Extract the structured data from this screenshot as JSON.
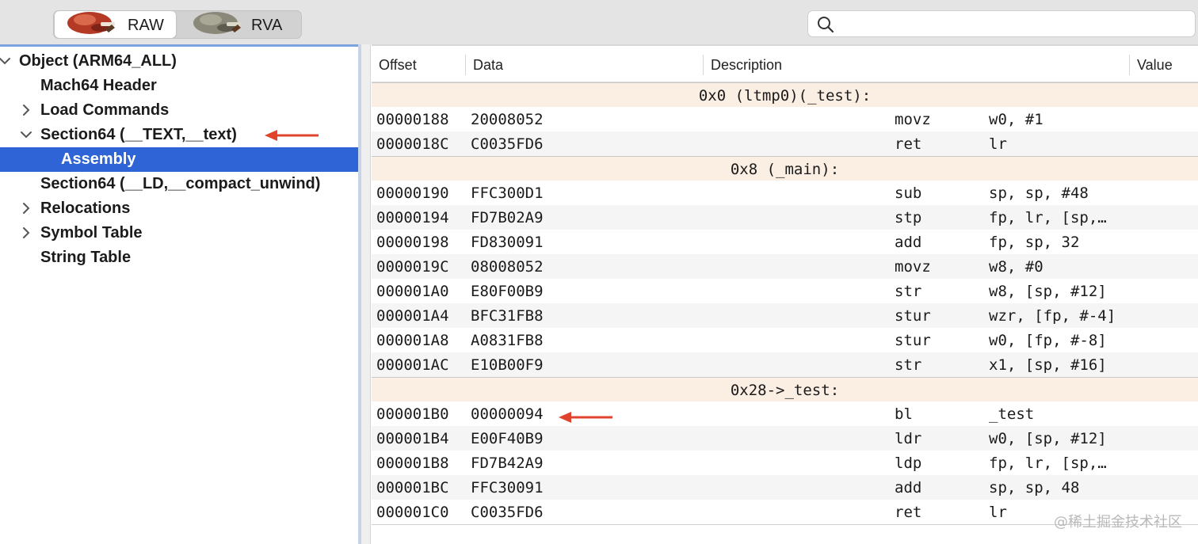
{
  "toolbar": {
    "mode_raw": "RAW",
    "mode_rva": "RVA",
    "search_placeholder": ""
  },
  "tree": {
    "items": [
      {
        "label": "Object  (ARM64_ALL)",
        "level": 0,
        "disclosure": "expanded-check"
      },
      {
        "label": "Mach64 Header",
        "level": 1,
        "disclosure": "none"
      },
      {
        "label": "Load Commands",
        "level": 1,
        "disclosure": "collapsed"
      },
      {
        "label": "Section64 (__TEXT,__text)",
        "level": 1,
        "disclosure": "expanded"
      },
      {
        "label": "Assembly",
        "level": 2,
        "disclosure": "none",
        "selected": true
      },
      {
        "label": "Section64 (__LD,__compact_unwind)",
        "level": 1,
        "disclosure": "none"
      },
      {
        "label": "Relocations",
        "level": 1,
        "disclosure": "collapsed"
      },
      {
        "label": "Symbol Table",
        "level": 1,
        "disclosure": "collapsed"
      },
      {
        "label": "String Table",
        "level": 1,
        "disclosure": "none"
      }
    ]
  },
  "table": {
    "columns": [
      "Offset",
      "Data",
      "Description",
      "Value"
    ],
    "rows": [
      {
        "label": "0x0 (ltmp0)(_test):"
      },
      {
        "offset": "00000188",
        "data": "20008052",
        "mnemonic": "movz",
        "operands": "w0, #1"
      },
      {
        "offset": "0000018C",
        "data": "C0035FD6",
        "mnemonic": "ret",
        "operands": "lr"
      },
      {
        "label": "0x8 (_main):"
      },
      {
        "offset": "00000190",
        "data": "FFC300D1",
        "mnemonic": "sub",
        "operands": "sp, sp, #48"
      },
      {
        "offset": "00000194",
        "data": "FD7B02A9",
        "mnemonic": "stp",
        "operands": "fp, lr, [sp,…"
      },
      {
        "offset": "00000198",
        "data": "FD830091",
        "mnemonic": "add",
        "operands": "fp, sp, 32"
      },
      {
        "offset": "0000019C",
        "data": "08008052",
        "mnemonic": "movz",
        "operands": "w8, #0"
      },
      {
        "offset": "000001A0",
        "data": "E80F00B9",
        "mnemonic": "str",
        "operands": "w8, [sp, #12]"
      },
      {
        "offset": "000001A4",
        "data": "BFC31FB8",
        "mnemonic": "stur",
        "operands": "wzr, [fp, #-4]"
      },
      {
        "offset": "000001A8",
        "data": "A0831FB8",
        "mnemonic": "stur",
        "operands": "w0, [fp, #-8]"
      },
      {
        "offset": "000001AC",
        "data": "E10B00F9",
        "mnemonic": "str",
        "operands": "x1, [sp, #16]"
      },
      {
        "label": "0x28->_test:"
      },
      {
        "offset": "000001B0",
        "data": "00000094",
        "mnemonic": "bl",
        "operands": "_test"
      },
      {
        "offset": "000001B4",
        "data": "E00F40B9",
        "mnemonic": "ldr",
        "operands": "w0, [sp, #12]"
      },
      {
        "offset": "000001B8",
        "data": "FD7B42A9",
        "mnemonic": "ldp",
        "operands": "fp, lr, [sp,…"
      },
      {
        "offset": "000001BC",
        "data": "FFC30091",
        "mnemonic": "add",
        "operands": "sp, sp, 48"
      },
      {
        "offset": "000001C0",
        "data": "C0035FD6",
        "mnemonic": "ret",
        "operands": "lr"
      }
    ]
  },
  "watermark": "@稀土掘金技术社区",
  "colors": {
    "selection": "#2f64d6",
    "label_row": "#fbeee3",
    "annotation_arrow": "#e0442c"
  }
}
